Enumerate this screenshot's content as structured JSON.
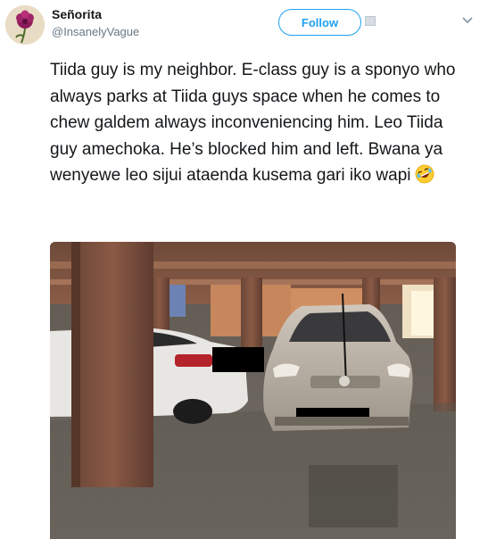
{
  "user": {
    "display_name": "Señorita",
    "handle": "@InsanelyVague"
  },
  "actions": {
    "follow_label": "Follow"
  },
  "tweet": {
    "text": "Tiida guy is my neighbor. E-class guy is a sponyo who always parks at Tiida guys space when he comes to chew galdem always inconveniencing him. Leo Tiida guy amechoka. He’s blocked him and left. Bwana ya wenyewe leo sijui ataenda kusema gari iko wapi",
    "emoji": "rolling-on-the-floor-laughing"
  },
  "colors": {
    "accent": "#1da1f2",
    "text": "#14171a",
    "secondary": "#657786"
  },
  "icons": [
    "avatar-flower",
    "follow-user-icon",
    "chevron-down-icon",
    "laughing-emoji-icon"
  ]
}
